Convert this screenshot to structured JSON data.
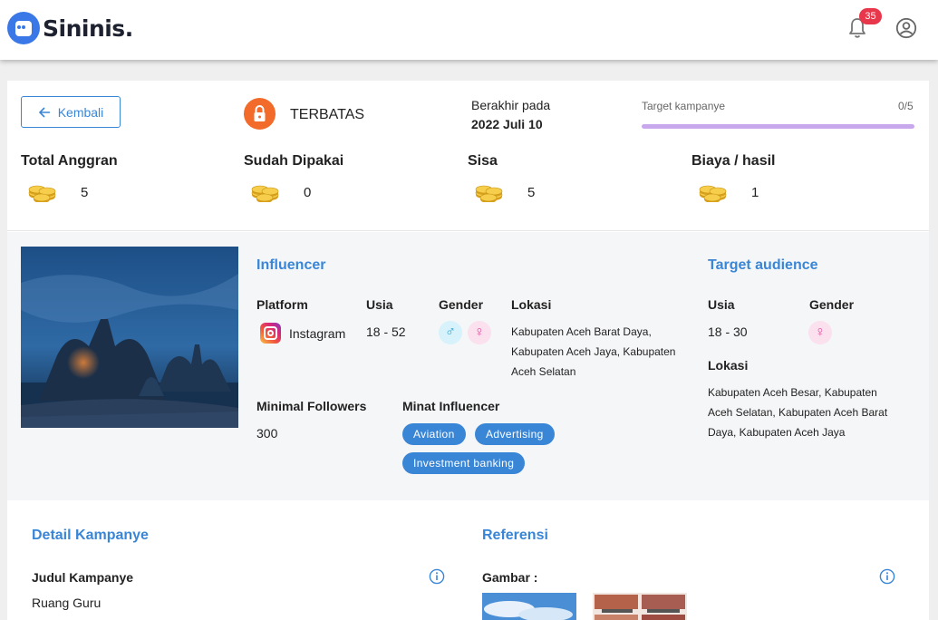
{
  "app": {
    "logo_text": "Sininis."
  },
  "header": {
    "notification_count": "35"
  },
  "summary": {
    "back_label": "Kembali",
    "status": "TERBATAS",
    "end_label": "Berakhir pada",
    "end_date": "2022 Juli 10",
    "target_label": "Target kampanye",
    "target_count": "0/5",
    "target_progress": 0,
    "stats": [
      {
        "label": "Total Anggran",
        "value": "5"
      },
      {
        "label": "Sudah Dipakai",
        "value": "0"
      },
      {
        "label": "Sisa",
        "value": "5"
      },
      {
        "label": "Biaya / hasil",
        "value": "1"
      }
    ]
  },
  "influencer": {
    "title": "Influencer",
    "platform_label": "Platform",
    "platform": "Instagram",
    "age_label": "Usia",
    "age": "18 - 52",
    "gender_label": "Gender",
    "location_label": "Lokasi",
    "location": "Kabupaten Aceh Barat Daya, Kabupaten Aceh Jaya, Kabupaten Aceh Selatan",
    "followers_label": "Minimal Followers",
    "followers": "300",
    "interest_label": "Minat Influencer",
    "interests": [
      "Aviation",
      "Advertising",
      "Investment banking"
    ]
  },
  "audience": {
    "title": "Target audience",
    "age_label": "Usia",
    "age": "18 - 30",
    "gender_label": "Gender",
    "location_label": "Lokasi",
    "location": "Kabupaten Aceh Besar, Kabupaten Aceh Selatan, Kabupaten Aceh Barat Daya, Kabupaten Aceh Jaya"
  },
  "detail": {
    "title": "Detail Kampanye",
    "campaign_title_label": "Judul Kampanye",
    "campaign_title": "Ruang Guru"
  },
  "reference": {
    "title": "Referensi",
    "image_label": "Gambar :"
  },
  "colors": {
    "accent": "#3a86d6",
    "lock": "#f26b2a",
    "progress_track": "#c8a8ec",
    "male": "#2aa7d8",
    "female": "#e052a3"
  }
}
